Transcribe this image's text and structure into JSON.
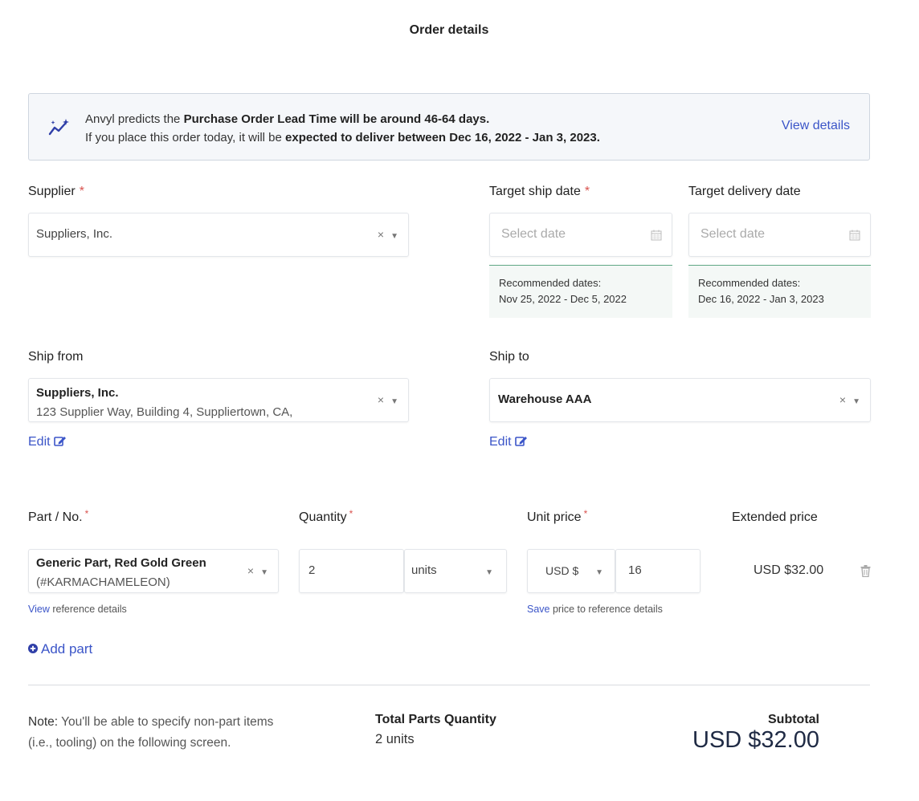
{
  "page": {
    "title": "Order details"
  },
  "banner": {
    "line1_prefix": "Anvyl predicts the ",
    "line1_bold": "Purchase Order Lead Time will be around 46-64 days.",
    "line2_prefix": "If you place this order today, it will be ",
    "line2_bold": "expected to deliver between Dec 16, 2022 - Jan 3, 2023.",
    "link": "View details",
    "icon": "sparkle-trend-icon"
  },
  "supplier": {
    "label": "Supplier",
    "required": "*",
    "value": "Suppliers, Inc.",
    "clear": "×",
    "caret": "▼"
  },
  "target_ship": {
    "label": "Target ship date",
    "required": "*",
    "placeholder": "Select date",
    "reco_label": "Recommended dates:",
    "reco_value": "Nov 25, 2022 - Dec 5, 2022"
  },
  "target_delivery": {
    "label": "Target delivery date",
    "placeholder": "Select date",
    "reco_label": "Recommended dates:",
    "reco_value": "Dec 16, 2022 - Jan 3, 2023"
  },
  "ship_from": {
    "label": "Ship from",
    "name": "Suppliers, Inc.",
    "address": "123 Supplier Way, Building 4, Suppliertown, CA,",
    "clear": "×",
    "caret": "▼",
    "edit": "Edit"
  },
  "ship_to": {
    "label": "Ship to",
    "name": "Warehouse AAA",
    "clear": "×",
    "caret": "▼",
    "edit": "Edit"
  },
  "parts": {
    "headers": {
      "part": "Part / No.",
      "quantity": "Quantity",
      "unit_price": "Unit price",
      "extended": "Extended price",
      "required": "*"
    },
    "row": {
      "part_name": "Generic Part, Red Gold Green",
      "part_no": "(#KARMACHAMELEON)",
      "clear": "×",
      "caret": "▼",
      "quantity": "2",
      "unit": "units",
      "currency": "USD $",
      "price": "16",
      "extended": "USD $32.00",
      "view_link": "View",
      "view_rest": " reference details",
      "save_link": "Save",
      "save_rest": " price to reference details"
    },
    "add_part": "Add part"
  },
  "footer": {
    "note_bold": "Note:",
    "note_rest": " You'll be able to specify non-part items",
    "note_line2": "(i.e., tooling) on the following screen.",
    "total_label": "Total Parts Quantity",
    "total_value": "2 units",
    "subtotal_label": "Subtotal",
    "subtotal_value": "USD $32.00"
  }
}
